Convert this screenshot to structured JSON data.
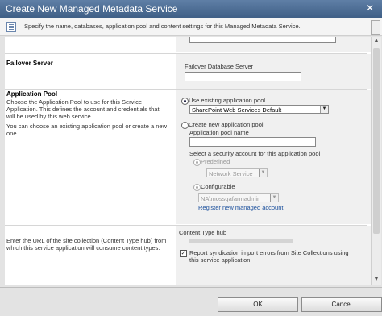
{
  "dialog": {
    "title": "Create New Managed Metadata Service",
    "close_glyph": "✕"
  },
  "info": {
    "text": "Specify the name, databases, application pool and content settings for this Managed Metadata Service."
  },
  "failover": {
    "heading": "Failover Server",
    "db_label": "Failover Database Server",
    "db_value": ""
  },
  "app_pool": {
    "heading": "Application Pool",
    "description": "Choose the Application Pool to use for this Service Application. This defines the account and credentials that will be used by this web service.",
    "description2": "You can choose an existing application pool or create a new one.",
    "use_existing_label": "Use existing application pool",
    "use_existing_selected": true,
    "existing_value": "SharePoint Web Services Default",
    "create_new_label": "Create new application pool",
    "pool_name_label": "Application pool name",
    "pool_name_value": "",
    "security_label": "Select a security account for this application pool",
    "predefined_label": "Predefined",
    "predefined_value": "Network Service",
    "configurable_label": "Configurable",
    "configurable_value": "NA\\mossqafarmadmin",
    "register_link": "Register new managed account"
  },
  "content_hub": {
    "description": "Enter the URL of the site collection (Content Type hub) from which this service application will consume content types.",
    "label": "Content Type hub",
    "report_label": "Report syndication import errors from Site Collections using this service application.",
    "report_checked": true
  },
  "footer": {
    "ok_label": "OK",
    "cancel_label": "Cancel"
  }
}
